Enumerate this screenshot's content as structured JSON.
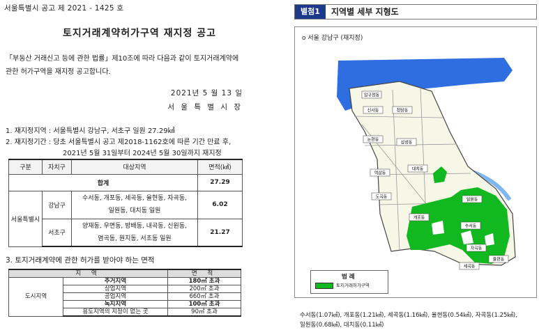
{
  "notice_number": "서울특별시 공고 제 2021 - 1425 호",
  "title": "토지거래계약허가구역 재지정 공고",
  "intro_line1": "「부동산 거래신고 등에 관한 법률」제10조에 따라 다음과 같이 토지거래계약에",
  "intro_line2": "관한 허가구역을 재지정 공고합니다.",
  "date": "2021년  5 월 13 일",
  "issuer": "서 울 특 별 시 장",
  "item1": "1. 재지정지역 : 서울특별시 강남구, 서초구 일원 27.29㎢",
  "item2": "2. 재지정기간 : 당초 서울특별시 공고 제2018-1162호에 따른 기간 만료 후,",
  "item2_cont": "2021년 5월 31일부터 2024년 5월 30일까지 재지정",
  "table1": {
    "headers": [
      "구분",
      "자치구",
      "대상지역",
      "면적(㎢)"
    ],
    "total_label": "합계",
    "total_value": "27.29",
    "region": "서울특별시",
    "rows": [
      {
        "district": "강남구",
        "areas_line1": "수서동, 개포동, 세곡동, 율현동, 자곡동,",
        "areas_line2": "일원동, 대치동 일원",
        "area": "6.02"
      },
      {
        "district": "서초구",
        "areas_line1": "양재동, 우면동, 방배동, 내곡동, 신원동,",
        "areas_line2": "염곡동, 원지동, 서초동 일원",
        "area": "21.27"
      }
    ]
  },
  "section3": "3. 토지거래계약에 관한 허가를 받아야 하는 면적",
  "table2": {
    "headers": [
      "지 역",
      "면 적"
    ],
    "group": "도시지역",
    "rows": [
      {
        "zone": "주거지역",
        "value": "180㎡ 초과",
        "bold": true
      },
      {
        "zone": "상업지역",
        "value": "200㎡ 초과",
        "bold": false
      },
      {
        "zone": "공업지역",
        "value": "660㎡ 초과",
        "bold": false
      },
      {
        "zone": "녹지지역",
        "value": "100㎡ 초과",
        "bold": true
      },
      {
        "zone": "용도지역의 지정이 없는 곳",
        "value": "90㎡ 초과",
        "bold": false
      }
    ]
  },
  "right_header": {
    "tag": "별첨1",
    "title": "지역별 세부 지형도"
  },
  "map_caption": "o 서울 강남구 (재지정)",
  "map_labels": [
    "압구정동",
    "신사동",
    "청담동",
    "논현동",
    "삼성동",
    "역삼동",
    "대치동",
    "도곡동",
    "개포동",
    "일원동",
    "수서동",
    "자곡동",
    "율현동",
    "세곡동"
  ],
  "legend_title": "범 례",
  "legend_label": "토지거래허가구역",
  "footer_line1": "수서동(1.07㎢), 개포동(1.21㎢), 세곡동(1.16㎢), 율현동(0.54㎢), 자곡동(1.25㎢),",
  "footer_line2": "일원동(0.68㎢), 대치동(0.11㎢)",
  "colors": {
    "zone_green": "#11b81f",
    "river_blue": "#2f6ee0",
    "header_blue": "#1d3a8a",
    "district_fill": "#f6f7e6"
  }
}
